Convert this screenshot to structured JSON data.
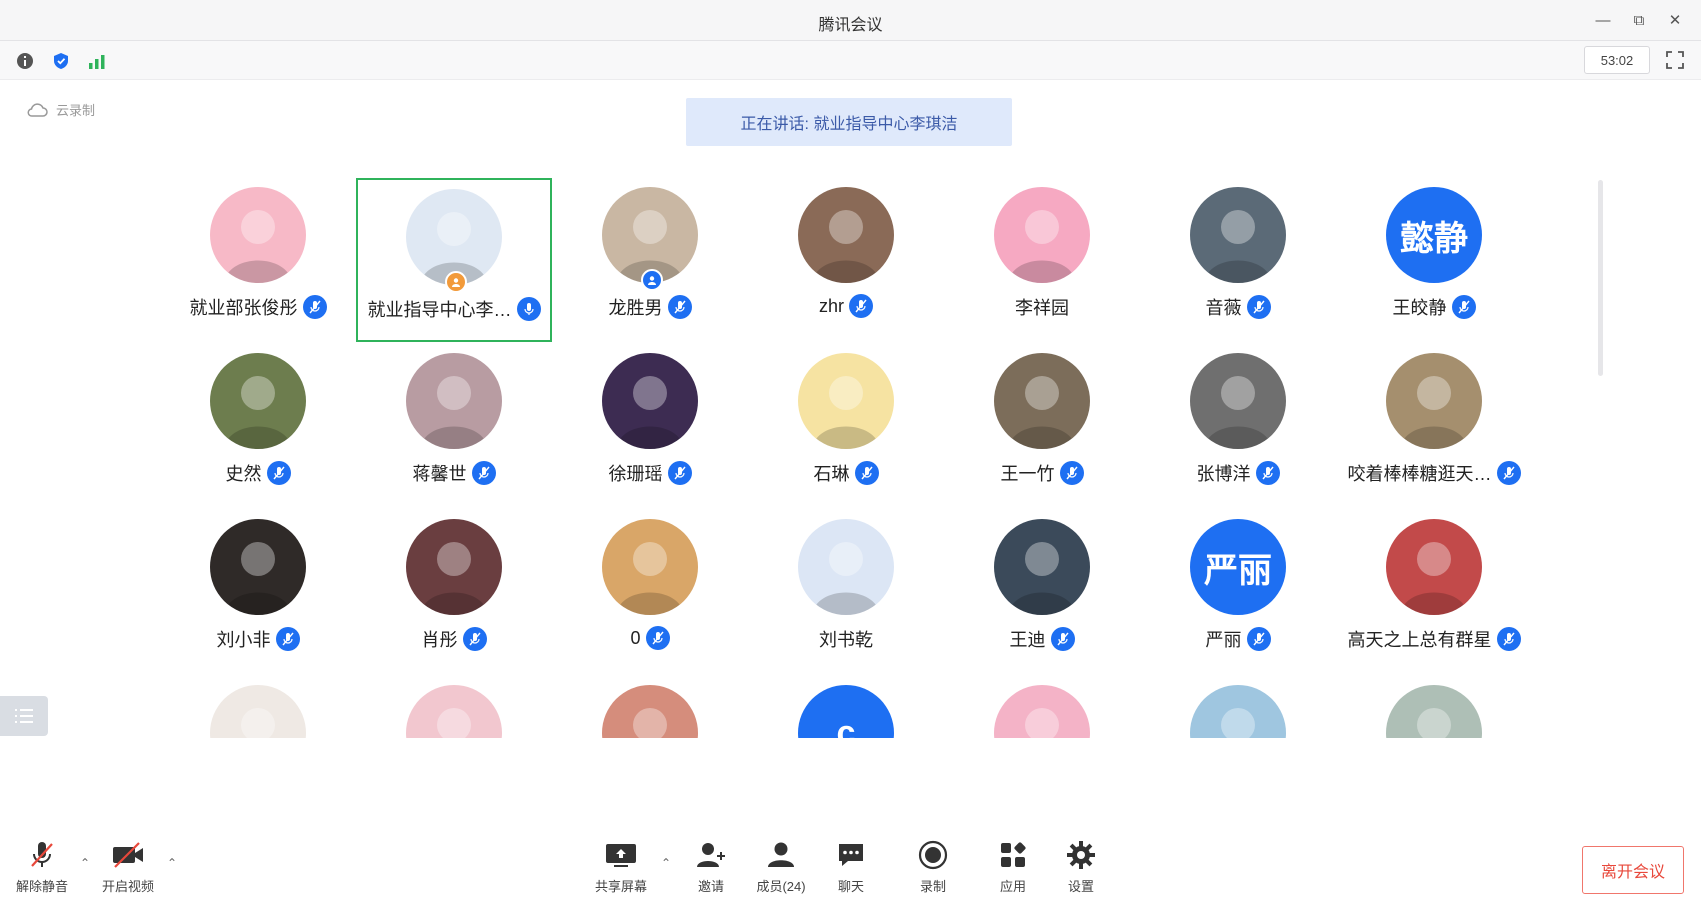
{
  "window": {
    "title": "腾讯会议"
  },
  "toolbar_top": {
    "timer": "53:02"
  },
  "recording": {
    "label": "云录制"
  },
  "speaker": {
    "text": "正在讲话: 就业指导中心李琪洁"
  },
  "participants": [
    {
      "name": "就业部张俊彤",
      "avatar": {
        "kind": "art",
        "bg": "#f7b9c7"
      }
    },
    {
      "name": "就业指导中心李…",
      "avatar": {
        "kind": "art",
        "bg": "#dfe8f3"
      },
      "host": true,
      "active": true
    },
    {
      "name": "龙胜男",
      "avatar": {
        "kind": "art",
        "bg": "#c9b7a3"
      },
      "cohost": true
    },
    {
      "name": "zhr",
      "avatar": {
        "kind": "art",
        "bg": "#8a6a57"
      }
    },
    {
      "name": "李祥园",
      "avatar": {
        "kind": "art",
        "bg": "#f6a9c2"
      },
      "nomic": true
    },
    {
      "name": "音薇",
      "avatar": {
        "kind": "art",
        "bg": "#5b6a77"
      }
    },
    {
      "name": "王皎静",
      "avatar": {
        "kind": "text",
        "bg": "#1e6ff2",
        "text": "懿静"
      }
    },
    {
      "name": "史然",
      "avatar": {
        "kind": "art",
        "bg": "#6d7d4e"
      }
    },
    {
      "name": "蒋馨世",
      "avatar": {
        "kind": "art",
        "bg": "#b89ca2"
      }
    },
    {
      "name": "徐珊瑶",
      "avatar": {
        "kind": "art",
        "bg": "#3d2c52"
      }
    },
    {
      "name": "石琳",
      "avatar": {
        "kind": "art",
        "bg": "#f6e3a2"
      }
    },
    {
      "name": "王一竹",
      "avatar": {
        "kind": "art",
        "bg": "#7c6d5a"
      }
    },
    {
      "name": "张博洋",
      "avatar": {
        "kind": "art",
        "bg": "#6f6f6f"
      }
    },
    {
      "name": "咬着棒棒糖逛天…",
      "avatar": {
        "kind": "art",
        "bg": "#a58f6e"
      }
    },
    {
      "name": "刘小非",
      "avatar": {
        "kind": "art",
        "bg": "#2f2a28"
      }
    },
    {
      "name": "肖彤",
      "avatar": {
        "kind": "art",
        "bg": "#6a3e40"
      }
    },
    {
      "name": "0",
      "avatar": {
        "kind": "art",
        "bg": "#d9a668"
      }
    },
    {
      "name": "刘书乾",
      "avatar": {
        "kind": "art",
        "bg": "#dce6f5"
      },
      "nomic": true
    },
    {
      "name": "王迪",
      "avatar": {
        "kind": "art",
        "bg": "#3b4a5a"
      }
    },
    {
      "name": "严丽",
      "avatar": {
        "kind": "text",
        "bg": "#1e6ff2",
        "text": "严丽"
      }
    },
    {
      "name": "高天之上总有群星",
      "avatar": {
        "kind": "art",
        "bg": "#c24a4a"
      }
    },
    {
      "name": "",
      "avatar": {
        "kind": "art",
        "bg": "#efe9e4"
      }
    },
    {
      "name": "",
      "avatar": {
        "kind": "art",
        "bg": "#f2c7cf"
      }
    },
    {
      "name": "",
      "avatar": {
        "kind": "art",
        "bg": "#d58d7c"
      }
    },
    {
      "name": "",
      "avatar": {
        "kind": "text",
        "bg": "#1e6ff2",
        "text": "c"
      }
    },
    {
      "name": "",
      "avatar": {
        "kind": "art",
        "bg": "#f4b3c7"
      }
    },
    {
      "name": "",
      "avatar": {
        "kind": "art",
        "bg": "#9fc6e0"
      }
    },
    {
      "name": "",
      "avatar": {
        "kind": "art",
        "bg": "#aebfb6"
      }
    }
  ],
  "bottom_toolbar": {
    "unmute": "解除静音",
    "start_video": "开启视频",
    "share_screen": "共享屏幕",
    "invite": "邀请",
    "participants": "成员(24)",
    "chat": "聊天",
    "record": "录制",
    "apps": "应用",
    "settings": "设置",
    "leave": "离开会议"
  },
  "colors": {
    "accent": "#1e6ff2",
    "active_border": "#2fb35b",
    "leave": "#e8483b"
  }
}
